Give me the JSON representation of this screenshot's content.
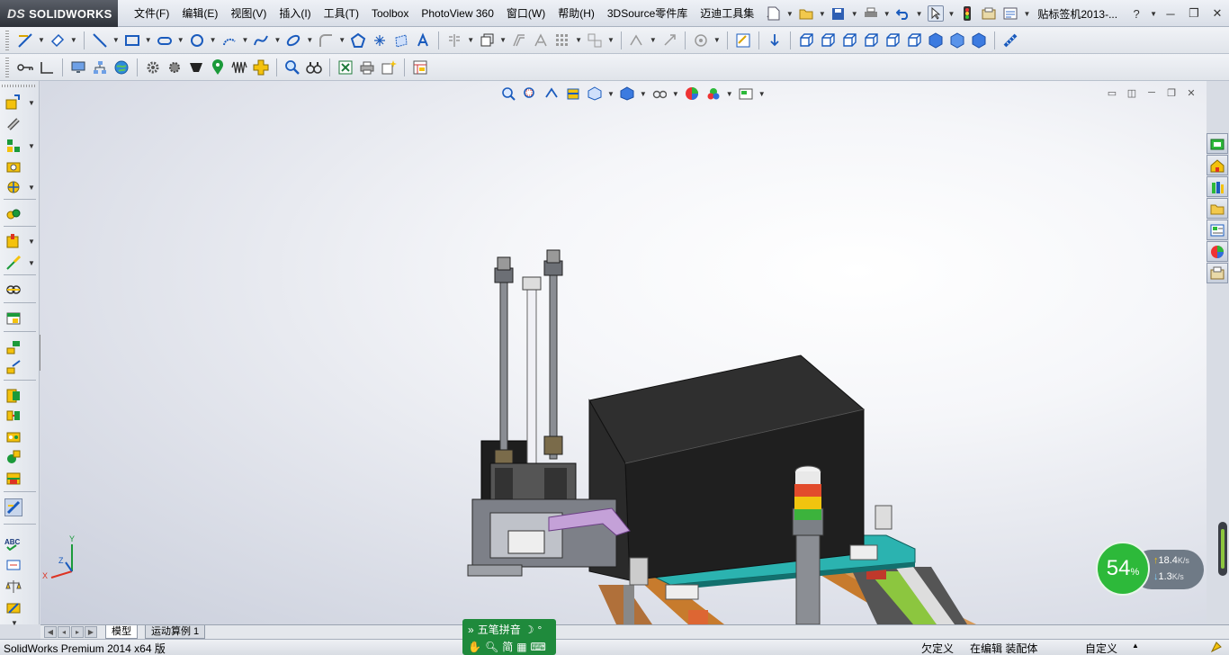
{
  "app": {
    "logo_prefix": "DS",
    "logo_text": "SOLIDWORKS",
    "document_title": "贴标签机2013-..."
  },
  "menu": [
    {
      "label": "文件(F)"
    },
    {
      "label": "编辑(E)"
    },
    {
      "label": "视图(V)"
    },
    {
      "label": "插入(I)"
    },
    {
      "label": "工具(T)"
    },
    {
      "label": "Toolbox"
    },
    {
      "label": "PhotoView 360"
    },
    {
      "label": "窗口(W)"
    },
    {
      "label": "帮助(H)"
    },
    {
      "label": "3DSource零件库"
    },
    {
      "label": "迈迪工具集"
    }
  ],
  "help_label": "?",
  "tabs": {
    "model": "模型",
    "motion": "运动算例 1"
  },
  "status": {
    "product": "SolidWorks Premium 2014 x64 版",
    "under_defined": "欠定义",
    "editing": "在编辑 装配体",
    "custom": "自定义"
  },
  "ime": {
    "name": "五笔拼音",
    "mode": "简"
  },
  "net": {
    "percent": "54",
    "percent_symbol": "%",
    "up_speed": "18.4",
    "up_unit": "K/s",
    "down_speed": "1.3",
    "down_unit": "K/s"
  },
  "triad": {
    "x": "X",
    "y": "Y",
    "z": "Z"
  },
  "colors": {
    "accent_blue": "#1a5bbd",
    "machine_black": "#2a2a2a",
    "plate_teal": "#2bb3b0",
    "bracket_purple": "#b58ec9",
    "ime_green": "#1f8a3c",
    "net_green": "#2db93a"
  }
}
